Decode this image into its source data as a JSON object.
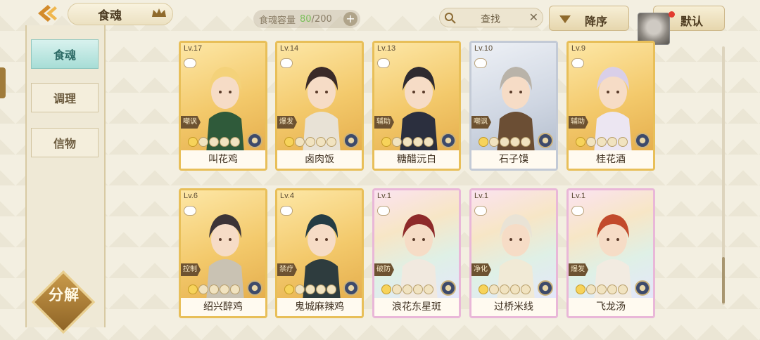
{
  "header": {
    "title": "食魂",
    "capacity_label": "食魂容量",
    "capacity_current": "80",
    "capacity_total": "/200",
    "plus": "+",
    "search_label": "查找",
    "clear": "✕",
    "sort_label": "降序",
    "default_label": "默认"
  },
  "sidebar": {
    "items": [
      {
        "label": "食魂"
      },
      {
        "label": "调理"
      },
      {
        "label": "信物"
      }
    ],
    "decompose_label": "分解"
  },
  "cards": [
    {
      "level": "Lv.17",
      "role": "嘲讽",
      "name": "叫花鸡",
      "stars_lit": 1
    },
    {
      "level": "Lv.14",
      "role": "爆发",
      "name": "卤肉饭",
      "stars_lit": 1
    },
    {
      "level": "Lv.13",
      "role": "辅助",
      "name": "糖醋沅白",
      "stars_lit": 1
    },
    {
      "level": "Lv.10",
      "role": "嘲讽",
      "name": "石子馍",
      "stars_lit": 1
    },
    {
      "level": "Lv.9",
      "role": "辅助",
      "name": "桂花酒",
      "stars_lit": 1
    },
    {
      "level": "Lv.6",
      "role": "控制",
      "name": "绍兴醉鸡",
      "stars_lit": 1
    },
    {
      "level": "Lv.4",
      "role": "禁疗",
      "name": "鬼城麻辣鸡",
      "stars_lit": 1
    },
    {
      "level": "Lv.1",
      "role": "破防",
      "name": "浪花东星斑",
      "stars_lit": 1
    },
    {
      "level": "Lv.1",
      "role": "净化",
      "name": "过桥米线",
      "stars_lit": 1
    },
    {
      "level": "Lv.1",
      "role": "爆发",
      "name": "飞龙汤",
      "stars_lit": 1
    }
  ],
  "colors": {
    "accent_gold": "#e8bf59",
    "active_tab": "#a7ddd6",
    "capacity_current": "#7bbf5a"
  }
}
